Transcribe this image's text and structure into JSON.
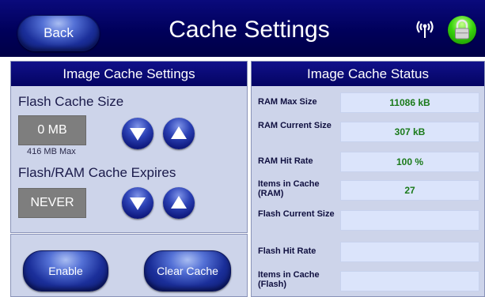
{
  "header": {
    "back_label": "Back",
    "title": "Cache Settings",
    "signal_icon": "wireless-signal-icon",
    "lock_icon": "lock-icon",
    "lock_color": "#2ecc1a"
  },
  "settings": {
    "heading": "Image Cache Settings",
    "flash_size_label": "Flash Cache Size",
    "flash_size_value": "0 MB",
    "flash_size_max": "416 MB Max",
    "expires_label": "Flash/RAM Cache Expires",
    "expires_value": "NEVER",
    "enable_label": "Enable",
    "clear_label": "Clear Cache"
  },
  "status": {
    "heading": "Image Cache Status",
    "rows": [
      {
        "label": "RAM Max Size",
        "value": "11086 kB"
      },
      {
        "label": "RAM Current Size",
        "value": "307 kB"
      },
      {
        "label": "RAM Hit Rate",
        "value": "100 %"
      },
      {
        "label": "Items in Cache (RAM)",
        "value": "27"
      },
      {
        "label": "Flash Current Size",
        "value": ""
      },
      {
        "label": "Flash Hit Rate",
        "value": ""
      },
      {
        "label": "Items in Cache (Flash)",
        "value": ""
      }
    ]
  },
  "colors": {
    "header_bg": "#000060",
    "panel_bg": "#cdd4ea",
    "status_value_text": "#1a7a1a"
  }
}
